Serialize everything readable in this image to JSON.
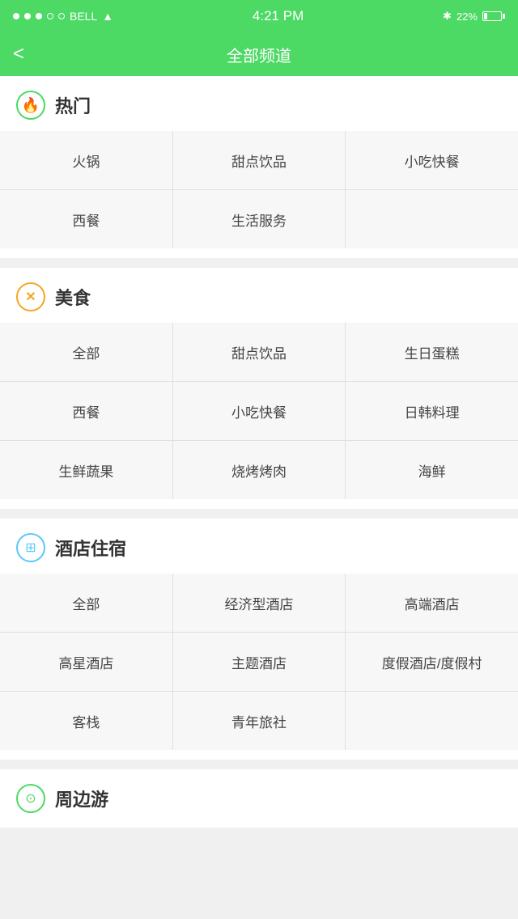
{
  "statusBar": {
    "carrier": "BELL",
    "time": "4:21 PM",
    "battery": "22%"
  },
  "navBar": {
    "title": "全部频道",
    "backLabel": "<"
  },
  "sections": [
    {
      "id": "hot",
      "iconType": "hot",
      "iconSymbol": "🔥",
      "title": "热门",
      "items": [
        "火锅",
        "甜点饮品",
        "小吃快餐",
        "西餐",
        "生活服务"
      ]
    },
    {
      "id": "food",
      "iconType": "food",
      "iconSymbol": "✕",
      "title": "美食",
      "items": [
        "全部",
        "甜点饮品",
        "生日蛋糕",
        "西餐",
        "小吃快餐",
        "日韩料理",
        "生鲜蔬果",
        "烧烤烤肉",
        "海鲜"
      ]
    },
    {
      "id": "hotel",
      "iconType": "hotel",
      "iconSymbol": "⊞",
      "title": "酒店住宿",
      "items": [
        "全部",
        "经济型酒店",
        "高端酒店",
        "高星酒店",
        "主题酒店",
        "度假酒店/度假村",
        "客栈",
        "青年旅社"
      ]
    },
    {
      "id": "nearby",
      "iconType": "nearby",
      "iconSymbol": "⊙",
      "title": "周边游",
      "items": []
    }
  ]
}
